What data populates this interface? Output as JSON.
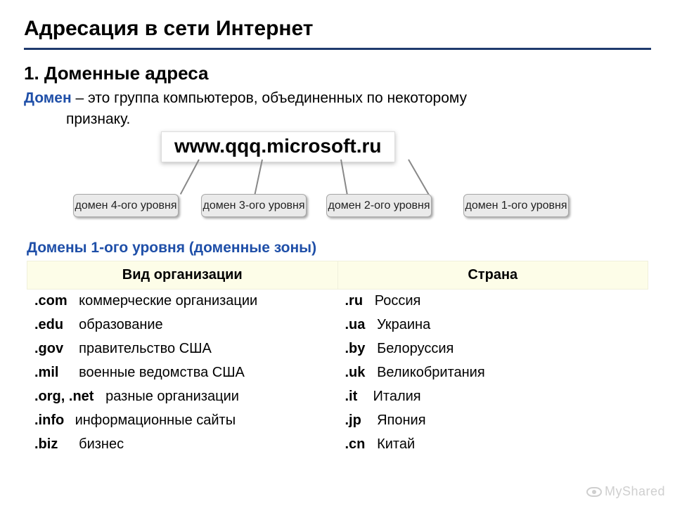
{
  "title": "Адресация в сети Интернет",
  "section_heading": "1. Доменные адреса",
  "definition_term": "Домен",
  "definition_rest": " – это группа компьютеров, объединенных по некоторому",
  "definition_line2": "признаку.",
  "example_domain": "www.qqq.microsoft.ru",
  "levels": {
    "l4": "домен 4-ого уровня",
    "l3": "домен 3-ого уровня",
    "l2": "домен 2-ого уровня",
    "l1": "домен 1-ого уровня"
  },
  "subtitle": "Домены 1-ого уровня (доменные зоны)",
  "table": {
    "header_org": "Вид организации",
    "header_country": "Страна",
    "rows": [
      {
        "tld": ".com",
        "org": "коммерческие организации",
        "ctld": ".ru",
        "country": "Россия"
      },
      {
        "tld": ".edu",
        "org": "образование",
        "ctld": ".ua",
        "country": "Украина"
      },
      {
        "tld": ".gov",
        "org": "правительство США",
        "ctld": ".by",
        "country": "Белоруссия"
      },
      {
        "tld": ".mil",
        "org": "военные ведомства США",
        "ctld": ".uk",
        "country": "Великобритания"
      },
      {
        "tld": ".org, .net",
        "org": "разные организации",
        "ctld": ".it",
        "country": "Италия"
      },
      {
        "tld": ".info",
        "org": "информационные сайты",
        "ctld": ".jp",
        "country": "Япония"
      },
      {
        "tld": ".biz",
        "org": "бизнес",
        "ctld": ".cn",
        "country": "Китай"
      }
    ]
  },
  "watermark": "MyShared"
}
